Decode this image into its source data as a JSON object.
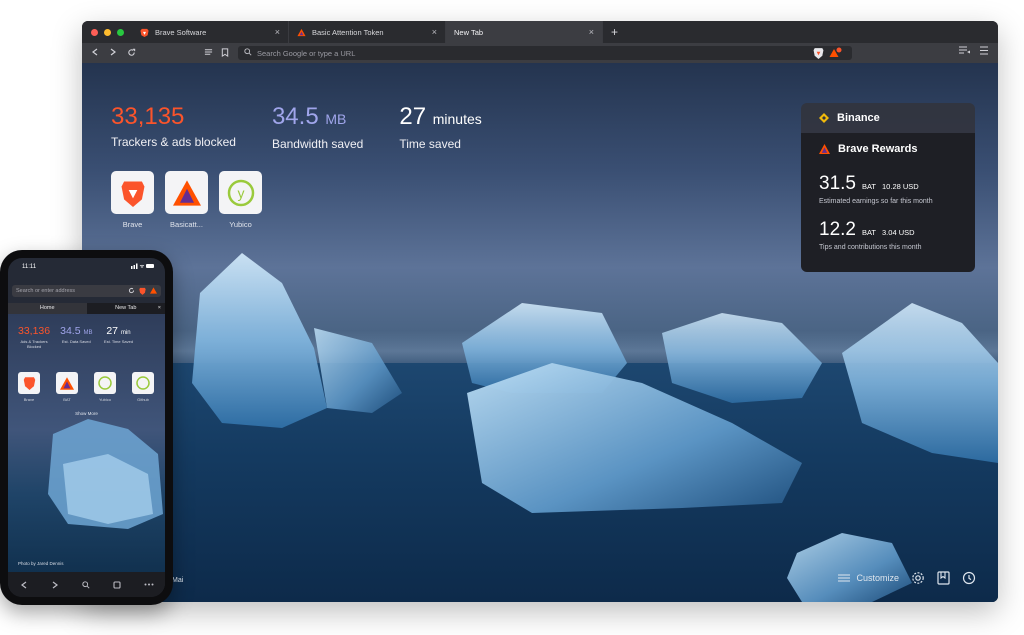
{
  "tabs": [
    {
      "title": "Brave Software",
      "favicon": "brave-lion-icon"
    },
    {
      "title": "Basic Attention Token",
      "favicon": "bat-triangle-icon"
    },
    {
      "title": "New Tab",
      "favicon": ""
    }
  ],
  "new_tab_symbol": "+",
  "close_symbol": "×",
  "toolbar": {
    "search_placeholder": "Search Google or type a URL"
  },
  "stats": {
    "trackers": {
      "value": "33,135",
      "label": "Trackers & ads blocked"
    },
    "bandwidth": {
      "value": "34.5",
      "unit": "MB",
      "label": "Bandwidth saved"
    },
    "time": {
      "value": "27",
      "unit": "minutes",
      "label": "Time saved"
    }
  },
  "top_sites": [
    {
      "label": "Brave"
    },
    {
      "label": "Basicatt..."
    },
    {
      "label": "Yubico"
    }
  ],
  "binance": {
    "title": "Binance"
  },
  "rewards": {
    "title": "Brave Rewards",
    "earnings": {
      "amount": "31.5",
      "unit": "BAT",
      "usd": "10.28 USD",
      "desc": "Estimated earnings so far this month"
    },
    "tips": {
      "amount": "12.2",
      "unit": "BAT",
      "usd": "3.04 USD",
      "desc": "Tips and contributions this month"
    }
  },
  "footer": {
    "photo_credit_fragment": "Mai",
    "customize": "Customize"
  },
  "colors": {
    "accent_orange": "#fb542b",
    "accent_violet": "#a0a5eb",
    "widget_bg": "#1e1f25"
  },
  "phone": {
    "time": "11:11",
    "url_placeholder": "Search or enter address",
    "tabs": {
      "home": "Home",
      "newtab": "New Tab"
    },
    "stats": [
      {
        "value": "33,136",
        "unit": "",
        "label": "Ads & Trackers Blocked"
      },
      {
        "value": "34.5",
        "unit": "MB",
        "label": "Est. Data Saved"
      },
      {
        "value": "27",
        "unit": "min",
        "label": "Est. Time Saved"
      }
    ],
    "sites": [
      {
        "label": "Brave"
      },
      {
        "label": "BAT"
      },
      {
        "label": "Yubico"
      },
      {
        "label": "Github"
      }
    ],
    "show_more": "Show More",
    "photo_credit": "Photo by Jared Dennis"
  }
}
